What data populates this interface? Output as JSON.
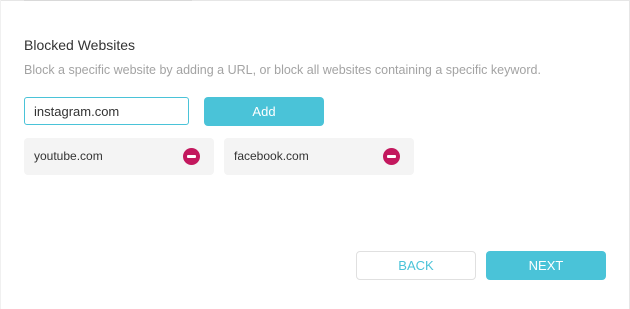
{
  "blocked_websites": {
    "title": "Blocked Websites",
    "description": "Block a specific website by adding a URL, or block all websites containing a specific keyword.",
    "input_value": "instagram.com",
    "add_label": "Add",
    "items": [
      {
        "label": "youtube.com",
        "remove_icon": "minus-circle-icon"
      },
      {
        "label": "facebook.com",
        "remove_icon": "minus-circle-icon"
      }
    ]
  },
  "footer": {
    "back_label": "BACK",
    "next_label": "NEXT"
  },
  "colors": {
    "accent": "#4ac3d8",
    "remove": "#c3185e",
    "chip_bg": "#f4f4f4",
    "muted_text": "#a3a3a3"
  }
}
